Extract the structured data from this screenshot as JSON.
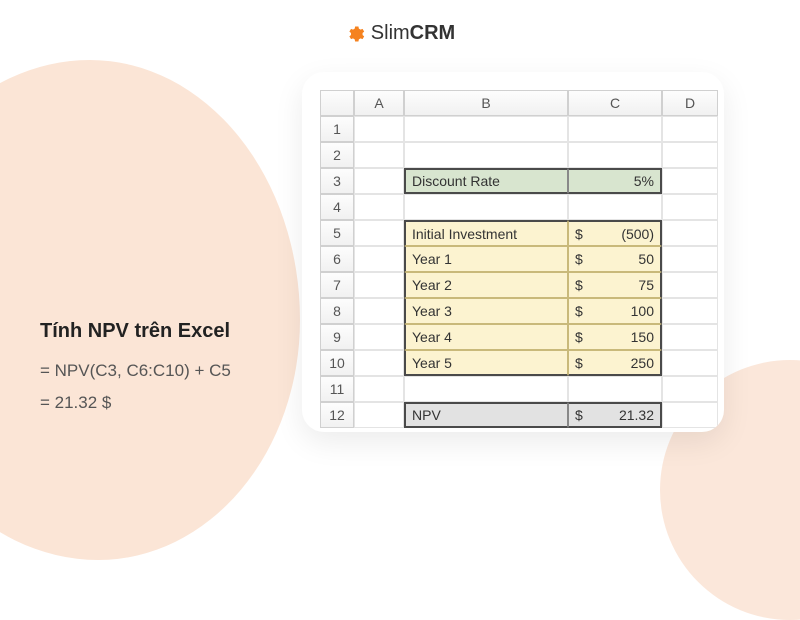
{
  "logo": {
    "brand_slim": "Slim",
    "brand_crm": "CRM"
  },
  "left": {
    "title": "Tính NPV trên Excel",
    "formula": "= NPV(C3, C6:C10) + C5",
    "result": "= 21.32 $"
  },
  "columns": {
    "row_blank": "",
    "A": "A",
    "B": "B",
    "C": "C",
    "D": "D"
  },
  "rows": [
    "1",
    "2",
    "3",
    "4",
    "5",
    "6",
    "7",
    "8",
    "9",
    "10",
    "11",
    "12"
  ],
  "sheet": {
    "discount_rate_label": "Discount Rate",
    "discount_rate_value": "5%",
    "initial_investment_label": "Initial Investment",
    "initial_investment_value": "(500)",
    "years": [
      {
        "label": "Year 1",
        "value": "50"
      },
      {
        "label": "Year 2",
        "value": "75"
      },
      {
        "label": "Year 3",
        "value": "100"
      },
      {
        "label": "Year 4",
        "value": "150"
      },
      {
        "label": "Year 5",
        "value": "250"
      }
    ],
    "npv_label": "NPV",
    "npv_value": "21.32",
    "currency": "$"
  },
  "chart_data": {
    "type": "table",
    "title": "Tính NPV trên Excel",
    "discount_rate_percent": 5,
    "initial_investment": -500,
    "cash_flows": [
      {
        "period": "Year 1",
        "amount": 50
      },
      {
        "period": "Year 2",
        "amount": 75
      },
      {
        "period": "Year 3",
        "amount": 100
      },
      {
        "period": "Year 4",
        "amount": 150
      },
      {
        "period": "Year 5",
        "amount": 250
      }
    ],
    "npv": 21.32,
    "formula": "= NPV(C3, C6:C10) + C5"
  }
}
